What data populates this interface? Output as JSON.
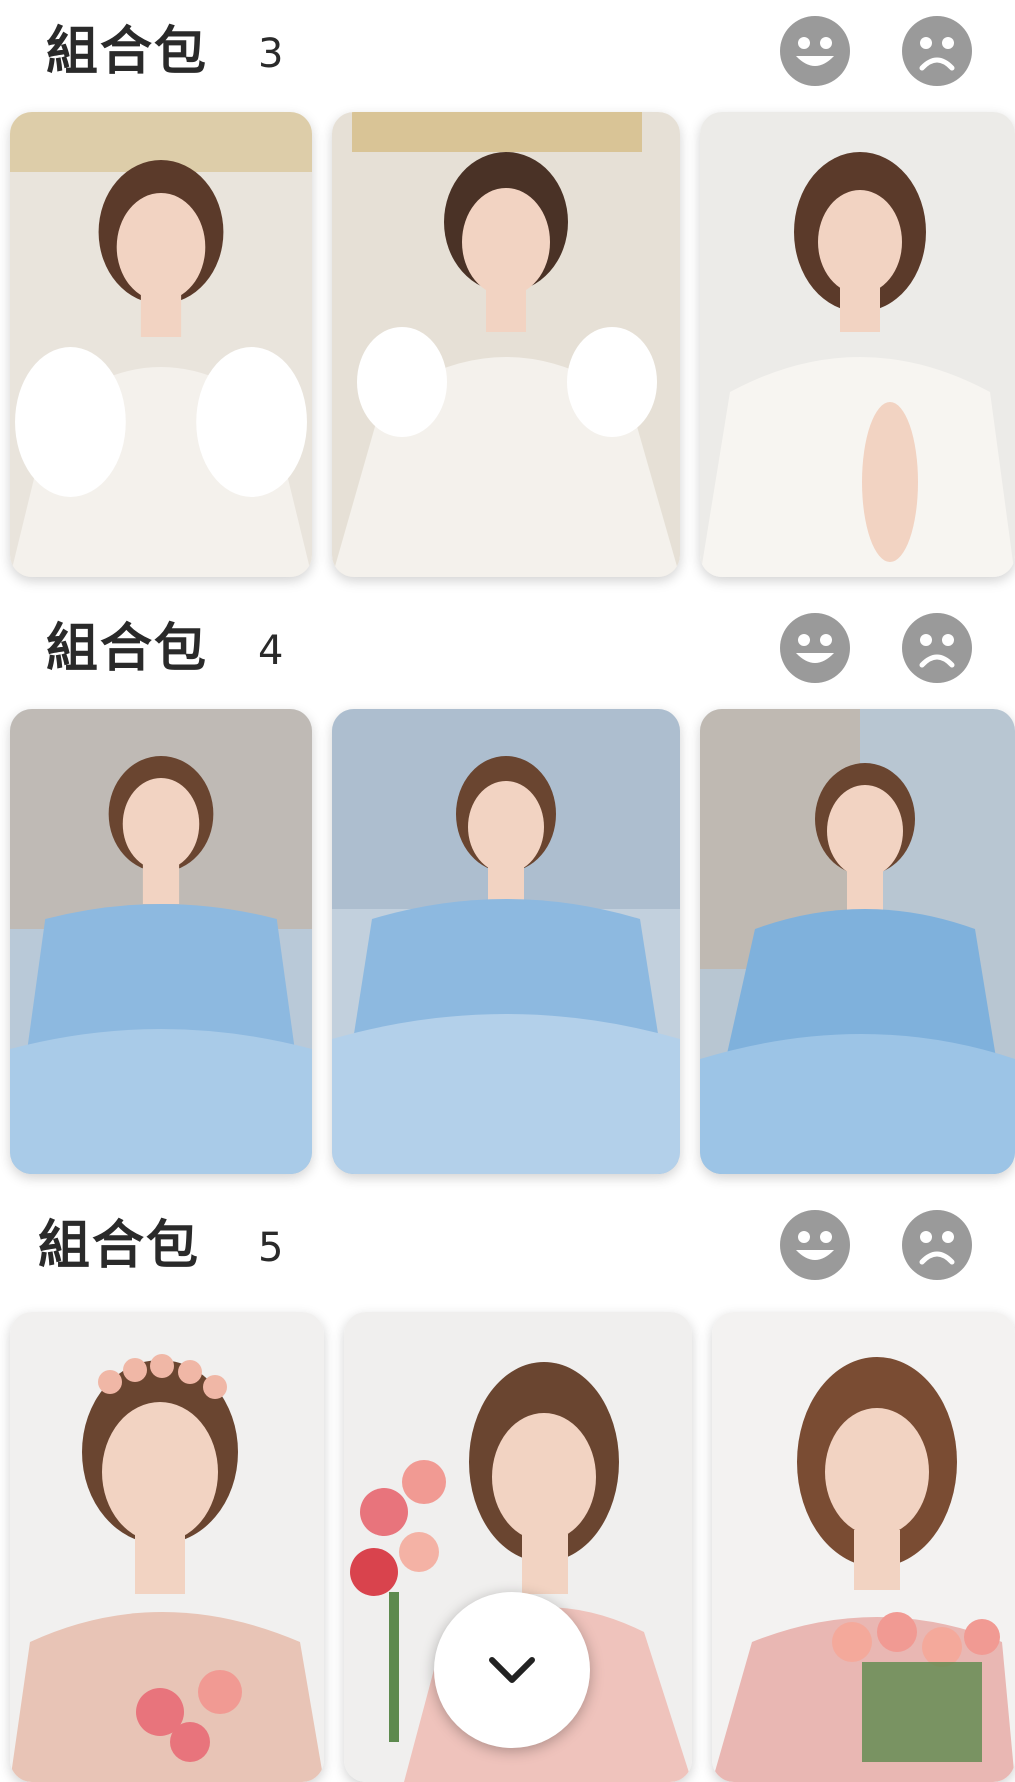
{
  "packs": [
    {
      "title": "組合包",
      "number": "3",
      "theme": "white-gown-palace",
      "dress_color": "#f4f1ec",
      "bg_color": "#e9e4dc",
      "accent": "#c9a24a"
    },
    {
      "title": "組合包",
      "number": "4",
      "theme": "blue-gown-european-street",
      "dress_color": "#8db9e0",
      "bg_color": "#b9c9d8",
      "accent": "#c7a98b"
    },
    {
      "title": "組合包",
      "number": "5",
      "theme": "pink-dress-roses",
      "dress_color": "#efc3bc",
      "bg_color": "#f1f0ef",
      "accent": "#e8747c"
    }
  ],
  "icons": {
    "like": "smiley-face-icon",
    "dislike": "frowning-face-icon",
    "scroll": "chevron-down-icon"
  },
  "colors": {
    "icon_gray": "#9a9a9a",
    "text": "#2a2a2a",
    "hair": "#5b3a2a",
    "skin": "#f2d3c2"
  }
}
